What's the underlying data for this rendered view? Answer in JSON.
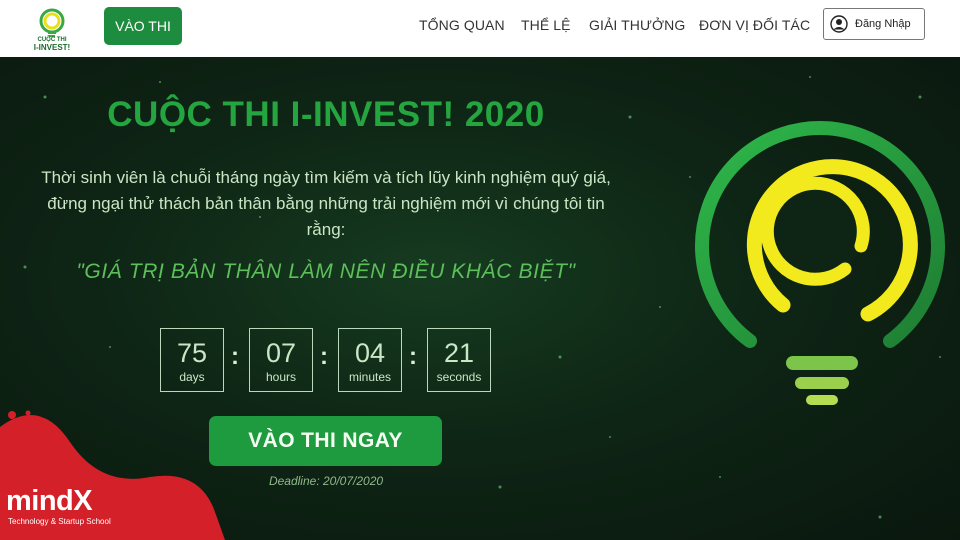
{
  "navbar": {
    "logo_text_line1": "CUỘC THI",
    "logo_text_line2": "I-INVEST!",
    "cta_label": "VÀO THI",
    "links": [
      "TỔNG QUAN",
      "THỂ LỆ",
      "GIẢI THƯỞNG",
      "ĐƠN VỊ ĐỐI TÁC"
    ],
    "login_label": "Đăng Nhập"
  },
  "hero": {
    "title": "CUỘC THI I-INVEST! 2020",
    "description": "Thời sinh viên là chuỗi tháng ngày tìm kiếm và tích lũy kinh nghiệm quý giá, đừng ngại thử thách bản thân bằng những trải nghiệm mới vì chúng tôi tin rằng:",
    "quote": "\"GIÁ TRỊ BẢN THÂN LÀM NÊN ĐIỀU KHÁC BIỆT\"",
    "countdown": [
      {
        "value": "75",
        "label": "days"
      },
      {
        "value": "07",
        "label": "hours"
      },
      {
        "value": "04",
        "label": "minutes"
      },
      {
        "value": "21",
        "label": "seconds"
      }
    ],
    "separator": ":",
    "cta_label": "VÀO THI NGAY",
    "deadline": "Deadline: 20/07/2020"
  },
  "watermark": {
    "brand": "mindX",
    "tagline": "Technology & Startup School"
  },
  "colors": {
    "brand_green": "#1e9a3f",
    "title_green": "#24a53f",
    "bulb_yellow": "#f2ea1c",
    "mindx_red": "#d42028"
  }
}
